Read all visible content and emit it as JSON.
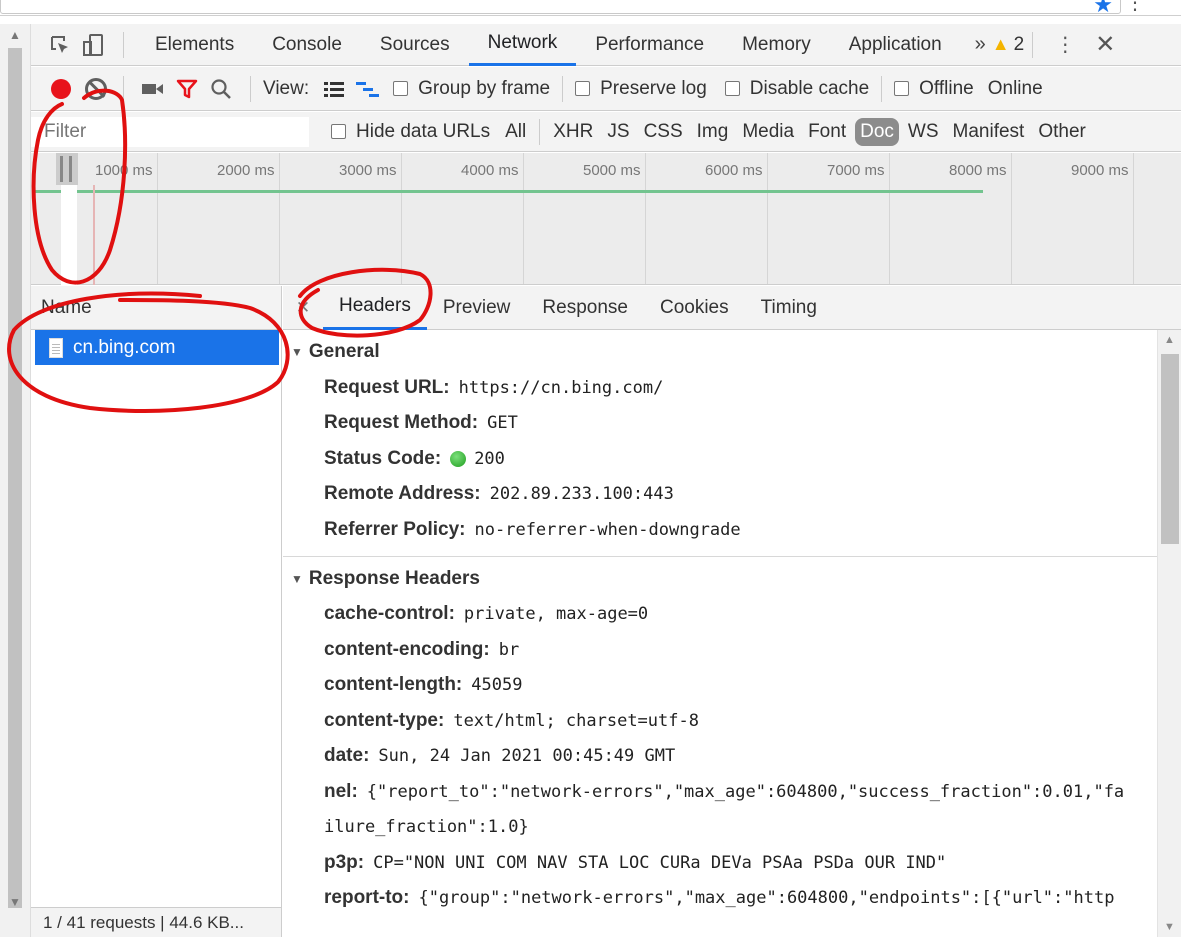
{
  "devtools_tabs": [
    "Elements",
    "Console",
    "Sources",
    "Network",
    "Performance",
    "Memory",
    "Application"
  ],
  "active_tab": "Network",
  "warnings_count": "2",
  "toolbar": {
    "view_label": "View:",
    "group_by_frame": "Group by frame",
    "preserve_log": "Preserve log",
    "disable_cache": "Disable cache",
    "offline": "Offline",
    "online": "Online"
  },
  "filter": {
    "placeholder": "Filter",
    "hide_data_urls": "Hide data URLs",
    "types": [
      "All",
      "XHR",
      "JS",
      "CSS",
      "Img",
      "Media",
      "Font",
      "Doc",
      "WS",
      "Manifest",
      "Other"
    ],
    "active_type": "Doc"
  },
  "overview": {
    "ticks": [
      "1000 ms",
      "2000 ms",
      "3000 ms",
      "4000 ms",
      "5000 ms",
      "6000 ms",
      "7000 ms",
      "8000 ms",
      "9000 ms"
    ]
  },
  "request_list": {
    "header": "Name",
    "rows": [
      "cn.bing.com"
    ],
    "status": "1 / 41 requests  |  44.6 KB..."
  },
  "details": {
    "tabs": [
      "Headers",
      "Preview",
      "Response",
      "Cookies",
      "Timing"
    ],
    "active_tab": "Headers",
    "general_title": "General",
    "general": [
      {
        "k": "Request URL:",
        "v": "https://cn.bing.com/"
      },
      {
        "k": "Request Method:",
        "v": "GET"
      },
      {
        "k": "Status Code:",
        "v": "200"
      },
      {
        "k": "Remote Address:",
        "v": "202.89.233.100:443"
      },
      {
        "k": "Referrer Policy:",
        "v": "no-referrer-when-downgrade"
      }
    ],
    "response_title": "Response Headers",
    "response": [
      {
        "k": "cache-control:",
        "v": "private, max-age=0"
      },
      {
        "k": "content-encoding:",
        "v": "br"
      },
      {
        "k": "content-length:",
        "v": "45059"
      },
      {
        "k": "content-type:",
        "v": "text/html; charset=utf-8"
      },
      {
        "k": "date:",
        "v": "Sun, 24 Jan 2021 00:45:49 GMT"
      },
      {
        "k": "nel:",
        "v": "{\"report_to\":\"network-errors\",\"max_age\":604800,\"success_fraction\":0.01,\"fa"
      },
      {
        "k": "",
        "v": "ilure_fraction\":1.0}"
      },
      {
        "k": "p3p:",
        "v": "CP=\"NON UNI COM NAV STA LOC CURa DEVa PSAa PSDa OUR IND\""
      },
      {
        "k": "report-to:",
        "v": "{\"group\":\"network-errors\",\"max_age\":604800,\"endpoints\":[{\"url\":\"http"
      }
    ]
  },
  "colors": {
    "accent": "#1a73e8",
    "record": "#e8131b",
    "annotation": "#e01010"
  }
}
